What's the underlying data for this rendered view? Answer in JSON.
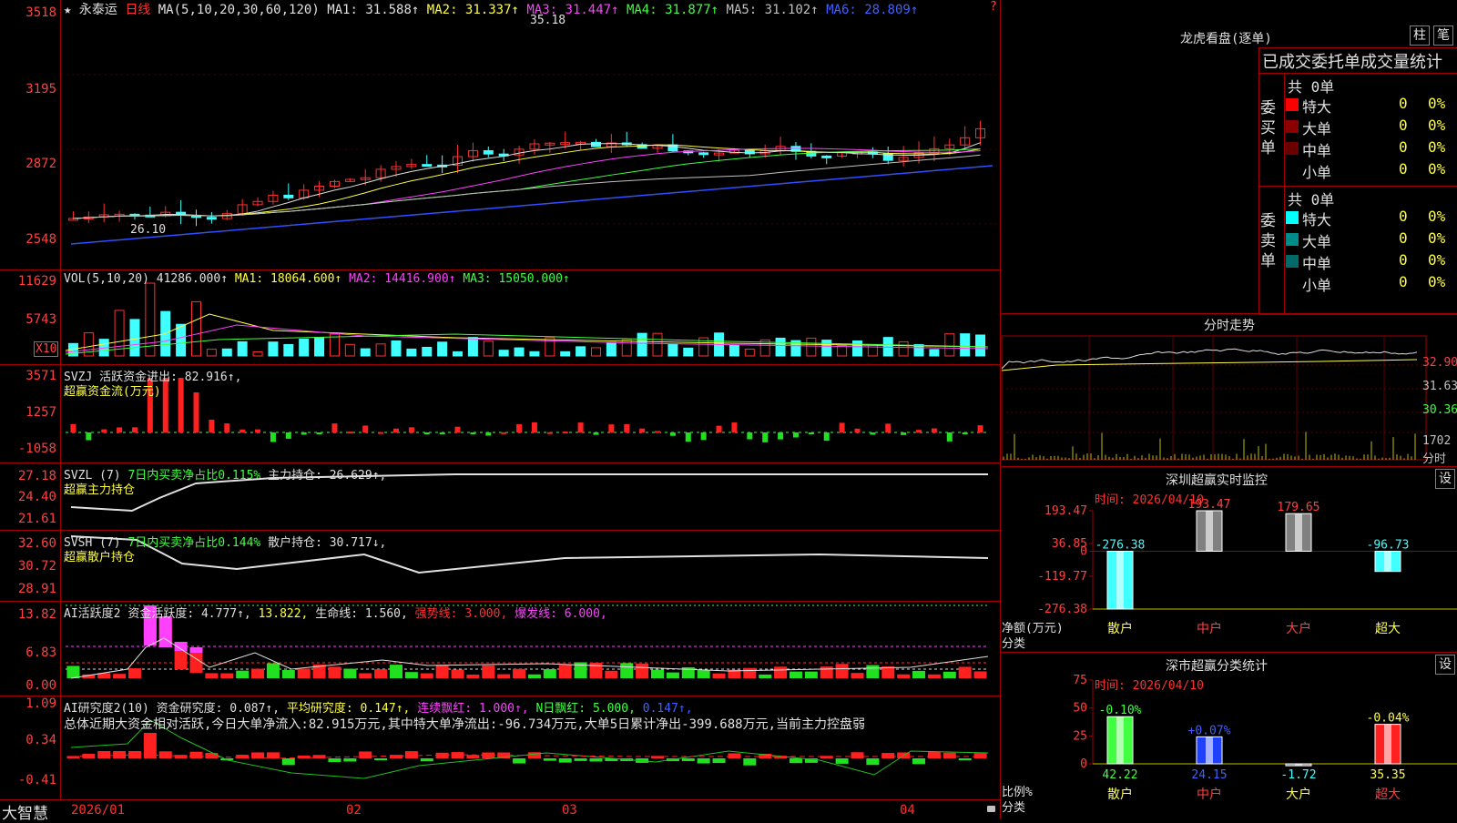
{
  "stock": {
    "name": "永泰运",
    "period": "日线",
    "star": "★"
  },
  "corner": {
    "question": "?"
  },
  "main_pane": {
    "ma_label": "MA(5,10,20,30,60,120)",
    "ma": [
      {
        "text": "MA1: 31.588↑",
        "color": "#e0e0e0"
      },
      {
        "text": "MA2: 31.337↑",
        "color": "#ffff40"
      },
      {
        "text": "MA3: 31.447↑",
        "color": "#ff40ff"
      },
      {
        "text": "MA4: 31.877↑",
        "color": "#40ff40"
      },
      {
        "text": "MA5: 31.102↑",
        "color": "#c0c0c0"
      },
      {
        "text": "MA6: 28.809↑",
        "color": "#4060ff"
      }
    ],
    "yticks": [
      "3518",
      "3195",
      "2872",
      "2548"
    ],
    "high_label": "35.18",
    "low_label": "26.10"
  },
  "vol_pane": {
    "label": "VOL(5,10,20)",
    "val": "41286.000↑",
    "ma1": "MA1: 18064.600↑",
    "ma2": "MA2: 14416.900↑",
    "ma3": "MA3: 15050.000↑",
    "yticks": [
      "11629",
      "5743"
    ],
    "unit": "X10"
  },
  "svzj_pane": {
    "label": "SVZJ",
    "text1": "活跃资金进出: 82.916↑,",
    "text2": "超赢资金流(万元)",
    "yticks": [
      "3571",
      "1257",
      "-1058"
    ]
  },
  "svzl_pane": {
    "label": "SVZL (7)",
    "text1": "7日内买卖净占比0.115%",
    "text2": "主力持仓: 26.629↑,",
    "text3": "超赢主力持仓",
    "yticks": [
      "27.18",
      "24.40",
      "21.61"
    ]
  },
  "svsh_pane": {
    "label": "SVSH (7)",
    "text1": "7日内买卖净占比0.144%",
    "text2": "散户持仓: 30.717↓,",
    "text3": "超赢散户持仓",
    "yticks": [
      "32.60",
      "30.72",
      "28.91"
    ]
  },
  "ai_active": {
    "label": "AI活跃度2",
    "t1": "资金活跃度: 4.777↑,",
    "t2": "13.822,",
    "t3": "生命线: 1.560,",
    "t4": "强势线: 3.000,",
    "t5": "爆发线: 6.000,",
    "yticks": [
      "13.82",
      "6.83",
      "0.00"
    ]
  },
  "ai_research": {
    "label": "AI研究度2(10)",
    "t1": "资金研究度: 0.087↑,",
    "t2": "平均研究度: 0.147↑,",
    "t3": "连续飘红: 1.000↑,",
    "t4": "N日飘红: 5.000,",
    "t5": "0.147↑,",
    "summary": "总体近期大资金相对活跃,今日大单净流入:82.915万元,其中特大单净流出:-96.734万元,大单5日累计净出-399.688万元,当前主力控盘弱",
    "yticks": [
      "1.09",
      "0.34",
      "-0.41"
    ]
  },
  "xaxis": {
    "brand": "大智慧",
    "labels": [
      "2026/01",
      "02",
      "03",
      "04"
    ]
  },
  "dragon": {
    "title": "龙虎看盘(逐单)",
    "btn_zhu": "柱",
    "btn_bi": "笔",
    "subtitle": "已成交委托单成交量统计",
    "buy": {
      "side_label": "委买单",
      "total": "共 0单",
      "rows": [
        {
          "name": "特大",
          "count": "0",
          "pct": "0%",
          "color": "#ff0000"
        },
        {
          "name": "大单",
          "count": "0",
          "pct": "0%",
          "color": "#8b0000"
        },
        {
          "name": "中单",
          "count": "0",
          "pct": "0%",
          "color": "#6a0000"
        },
        {
          "name": "小单",
          "count": "0",
          "pct": "0%",
          "color": ""
        }
      ]
    },
    "sell": {
      "side_label": "委卖单",
      "total": "共 0单",
      "rows": [
        {
          "name": "特大",
          "count": "0",
          "pct": "0%",
          "color": "#00ffff"
        },
        {
          "name": "大单",
          "count": "0",
          "pct": "0%",
          "color": "#008b8b"
        },
        {
          "name": "中单",
          "count": "0",
          "pct": "0%",
          "color": "#006a6a"
        },
        {
          "name": "小单",
          "count": "0",
          "pct": "0%",
          "color": ""
        }
      ]
    }
  },
  "intraday": {
    "title": "分时走势",
    "yticks": [
      "32.90",
      "31.63",
      "30.36"
    ],
    "vol_tick": "1702",
    "vol_unit": "分时"
  },
  "sz_monitor": {
    "title": "深圳超赢实时监控",
    "btn": "设",
    "time": "时间: 2026/04/10",
    "yticks": [
      "193.47",
      "36.85",
      "0",
      "-119.77",
      "-276.38"
    ],
    "ylabel1": "净额(万元)",
    "ylabel2": "分类"
  },
  "sz_stats": {
    "title": "深市超赢分类统计",
    "btn": "设",
    "time": "时间: 2026/04/10",
    "yticks": [
      "75",
      "50",
      "25",
      "0"
    ],
    "ylabel1": "比例%",
    "ylabel2": "分类"
  },
  "chart_data": [
    {
      "type": "bar",
      "title": "深圳超赢实时监控",
      "ylabel": "净额(万元)",
      "xlabel": "分类",
      "categories": [
        "散户",
        "中户",
        "大户",
        "超大"
      ],
      "values": [
        -276.38,
        193.47,
        179.65,
        -96.73
      ],
      "ylim": [
        -276.38,
        193.47
      ]
    },
    {
      "type": "bar",
      "title": "深市超赢分类统计",
      "ylabel": "比例%",
      "xlabel": "分类",
      "categories": [
        "散户",
        "中户",
        "大户",
        "超大"
      ],
      "values": [
        42.22,
        24.15,
        -1.72,
        35.35
      ],
      "change_labels": [
        "-0.10%",
        "+0.07%",
        "",
        "-0.04%"
      ],
      "ylim": [
        0,
        75
      ]
    }
  ]
}
